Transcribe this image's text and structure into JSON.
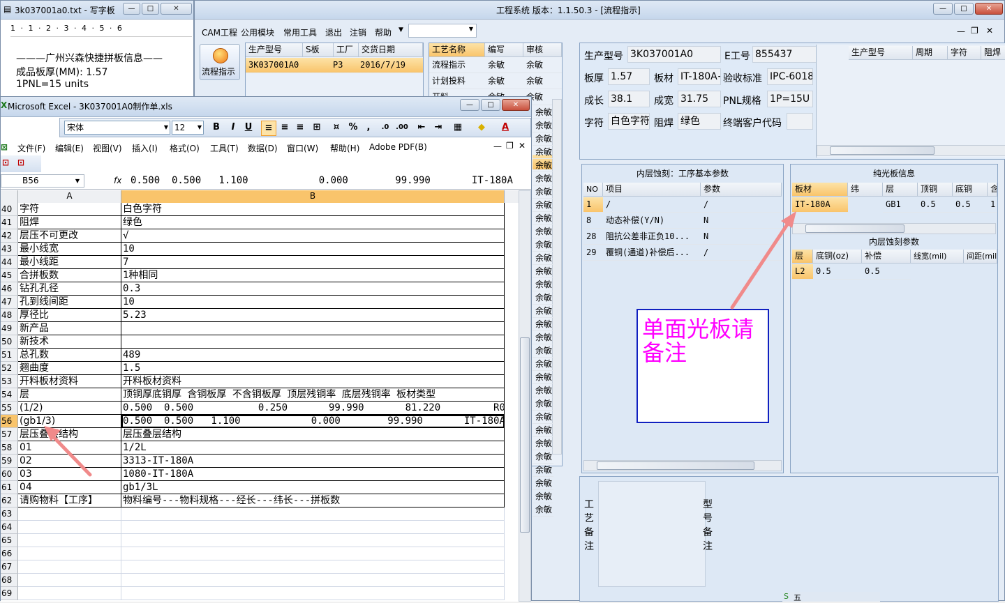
{
  "notepad": {
    "title": "3k037001a0.txt - 写字板",
    "ruler": "1 · 1 · 2 · 3 · 4 · 5 · 6",
    "lines": [
      "———广州兴森快捷拼板信息——",
      "成品板厚(MM): 1.57",
      "1PNL=15 units"
    ]
  },
  "main": {
    "title": "工程系统   版本：1.1.50.3 - [流程指示]",
    "menu": [
      "CAM工程",
      "公用模块",
      "常用工具",
      "退出",
      "注销",
      "帮助"
    ],
    "flow_button": "流程指示",
    "orders": {
      "headers": [
        "生产型号",
        "S板",
        "工厂",
        "交货日期"
      ],
      "row": [
        "3K037001A0",
        "",
        "P3",
        "2016/7/19"
      ]
    },
    "processes": {
      "headers": [
        "工艺名称",
        "编写",
        "审核"
      ],
      "rows": [
        [
          "流程指示",
          "余敏",
          "余敏"
        ],
        [
          "计划投料",
          "余敏",
          "余敏"
        ],
        [
          "开料",
          "余敏",
          "余敏"
        ]
      ],
      "extra_cells": [
        "余敏",
        "余敏",
        "余敏",
        "余敏",
        "余敏",
        "余敏",
        "余敏",
        "余敏",
        "余敏",
        "余敏",
        "余敏",
        "余敏",
        "余敏",
        "余敏",
        "余敏",
        "余敏",
        "余敏",
        "余敏",
        "余敏",
        "余敏",
        "余敏",
        "余敏",
        "余敏",
        "余敏",
        "余敏",
        "余敏",
        "余敏",
        "余敏",
        "余敏",
        "余敏",
        "余敏"
      ]
    },
    "info": {
      "model_label": "生产型号",
      "model_value": "3K037001A0",
      "eng_label": "E工号",
      "eng_value": "855437",
      "thick_label": "板厚",
      "thick_value": "1.57",
      "material_label": "板材",
      "material_value": "IT-180A+",
      "std_label": "验收标准",
      "std_value": "IPC-6018",
      "len_label": "成长",
      "len_value": "38.1",
      "wid_label": "成宽",
      "wid_value": "31.75",
      "pnl_label": "PNL规格",
      "pnl_value": "1P=15U",
      "char_label": "字符",
      "char_value": "白色字符",
      "mask_label": "阻焊",
      "mask_value": "绿色",
      "cust_label": "终端客户代码",
      "cust_value": ""
    },
    "side_grid_headers": [
      "生产型号",
      "周期",
      "字符",
      "阻焊"
    ],
    "inner": {
      "title": "内层蚀刻：工序基本参数",
      "headers": [
        "NO",
        "项目",
        "参数"
      ],
      "rows": [
        [
          "1",
          "/",
          "/"
        ],
        [
          "8",
          "动态补偿(Y/N)",
          "N"
        ],
        [
          "28",
          "阻抗公差非正负10...",
          "N"
        ],
        [
          "29",
          "覆铜(通道)补偿后...",
          "/"
        ]
      ]
    },
    "bare": {
      "title": "纯光板信息",
      "headers": [
        "板材",
        "纬",
        "层",
        "顶铜",
        "底铜",
        "含"
      ],
      "row": [
        "IT-180A",
        "",
        "GB1",
        "0.5",
        "0.5",
        "1."
      ]
    },
    "etch": {
      "title": "内层蚀刻参数",
      "headers": [
        "层",
        "底铜(oz)",
        "补偿",
        "线宽(mil)",
        "间距(mil)"
      ],
      "row": [
        "L2",
        "0.5",
        "0.5",
        "",
        ""
      ]
    },
    "note": "单面光板请备注",
    "remarks": {
      "process": "工艺备注",
      "model": "型号备注"
    },
    "taskbar_text": "五"
  },
  "excel": {
    "title": "Microsoft Excel - 3K037001A0制作单.xls",
    "font": "宋体",
    "size": "12",
    "menu": [
      "文件(F)",
      "编辑(E)",
      "视图(V)",
      "插入(I)",
      "格式(O)",
      "工具(T)",
      "数据(D)",
      "窗口(W)",
      "帮助(H)",
      "Adobe PDF(B)"
    ],
    "namebox": "B56",
    "fx": "fx",
    "formula": "0.500  0.500   1.100            0.000        99.990       IT-180A",
    "col_a": "A",
    "col_b": "B",
    "rows": [
      {
        "n": "40",
        "a": "字符",
        "b": "白色字符"
      },
      {
        "n": "41",
        "a": "阻焊",
        "b": "绿色"
      },
      {
        "n": "42",
        "a": "层压不可更改",
        "b": "√"
      },
      {
        "n": "43",
        "a": "最小线宽",
        "b": "10"
      },
      {
        "n": "44",
        "a": "最小线距",
        "b": "7"
      },
      {
        "n": "45",
        "a": "合拼板数",
        "b": "1种相同"
      },
      {
        "n": "46",
        "a": "钻孔孔径",
        "b": "0.3"
      },
      {
        "n": "47",
        "a": "孔到线间距",
        "b": "10"
      },
      {
        "n": "48",
        "a": "厚径比",
        "b": "5.23"
      },
      {
        "n": "49",
        "a": "新产品",
        "b": ""
      },
      {
        "n": "50",
        "a": "新技术",
        "b": ""
      },
      {
        "n": "51",
        "a": "总孔数",
        "b": "489"
      },
      {
        "n": "52",
        "a": "翘曲度",
        "b": "1.5"
      },
      {
        "n": "53",
        "a": "开料板材资料",
        "b": "开料板材资料"
      },
      {
        "n": "54",
        "a": "层",
        "b": "顶铜厚底铜厚 含铜板厚 不含铜板厚 顶层残铜率 底层残铜率 板材类型"
      },
      {
        "n": "55",
        "a": "(1/2)",
        "b": "0.500  0.500           0.250       99.990       81.220         R04350B"
      },
      {
        "n": "56",
        "a": "(gb1/3)",
        "b": "0.500  0.500   1.100            0.000        99.990       IT-180A"
      },
      {
        "n": "57",
        "a": "层压叠层结构",
        "b": "层压叠层结构"
      },
      {
        "n": "58",
        "a": "01",
        "b": "1/2L"
      },
      {
        "n": "59",
        "a": "02",
        "b": "3313-IT-180A"
      },
      {
        "n": "60",
        "a": "03",
        "b": "1080-IT-180A"
      },
      {
        "n": "61",
        "a": "04",
        "b": "gb1/3L"
      },
      {
        "n": "62",
        "a": "请购物料【工序】",
        "b": "物料编号---物料规格---经长---纬长---拼板数"
      },
      {
        "n": "63",
        "a": "",
        "b": ""
      },
      {
        "n": "64",
        "a": "",
        "b": ""
      },
      {
        "n": "65",
        "a": "",
        "b": ""
      },
      {
        "n": "66",
        "a": "",
        "b": ""
      },
      {
        "n": "67",
        "a": "",
        "b": ""
      },
      {
        "n": "68",
        "a": "",
        "b": ""
      },
      {
        "n": "69",
        "a": "",
        "b": ""
      }
    ]
  },
  "colors": {
    "accent_orange": "#f9c46b",
    "note_text": "#ff00ff",
    "note_border": "#1020c0",
    "arrow": "#f08a8a"
  }
}
